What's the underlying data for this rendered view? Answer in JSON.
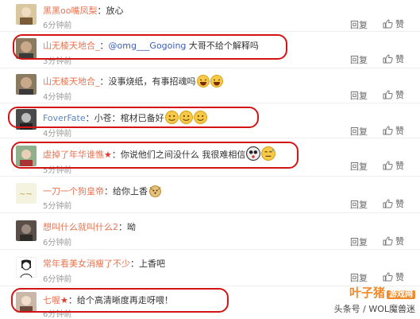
{
  "actions": {
    "reply_label": "回复",
    "like_label": "赞"
  },
  "comments": [
    {
      "user": "黑黑oo嘴凤梨",
      "sep": "：",
      "text": "放心",
      "time": "6分钟前"
    },
    {
      "user": "山无棱天地合_",
      "sep": "：",
      "mention": "@omg___Gogoing",
      "text": " 大哥不给个解释吗",
      "time": "3分钟前"
    },
    {
      "user": "山无棱天地合_",
      "sep": "：",
      "text": "没事烧纸，有事招魂吗",
      "time": "4分钟前"
    },
    {
      "user": "FoverFate",
      "sep": "：",
      "text": "小苍：棺材已备好",
      "time": "4分钟前"
    },
    {
      "user": "虐掉了年华谁憔",
      "sep": "：",
      "text": "你说他们之间没什么  我很难相信",
      "time": "5分钟前"
    },
    {
      "user": "一刀一个狗皇帝",
      "sep": "：",
      "text": "给你上香",
      "time": "5分钟前"
    },
    {
      "user": "想叫什么就叫什么2",
      "sep": "：",
      "text": "呦",
      "time": "6分钟前"
    },
    {
      "user": "常年看美女消瘦了不少",
      "sep": "：",
      "text": "上香吧",
      "time": "6分钟前"
    },
    {
      "user": "七喔",
      "sep": "：",
      "text": "给个高清晰度再走呀喂！",
      "time": "6分钟前"
    }
  ],
  "watermark": {
    "logo": "叶子猪",
    "logo_tag": "游戏网",
    "credit": "头条号 / WOL魔兽迷"
  },
  "icons": {
    "like": "thumbs-up-icon",
    "emoji": "emoji-icon",
    "star": "star-icon"
  },
  "colors": {
    "username": "#eb7350",
    "mention": "#3b5dbb",
    "highlight_box": "#d31414"
  }
}
